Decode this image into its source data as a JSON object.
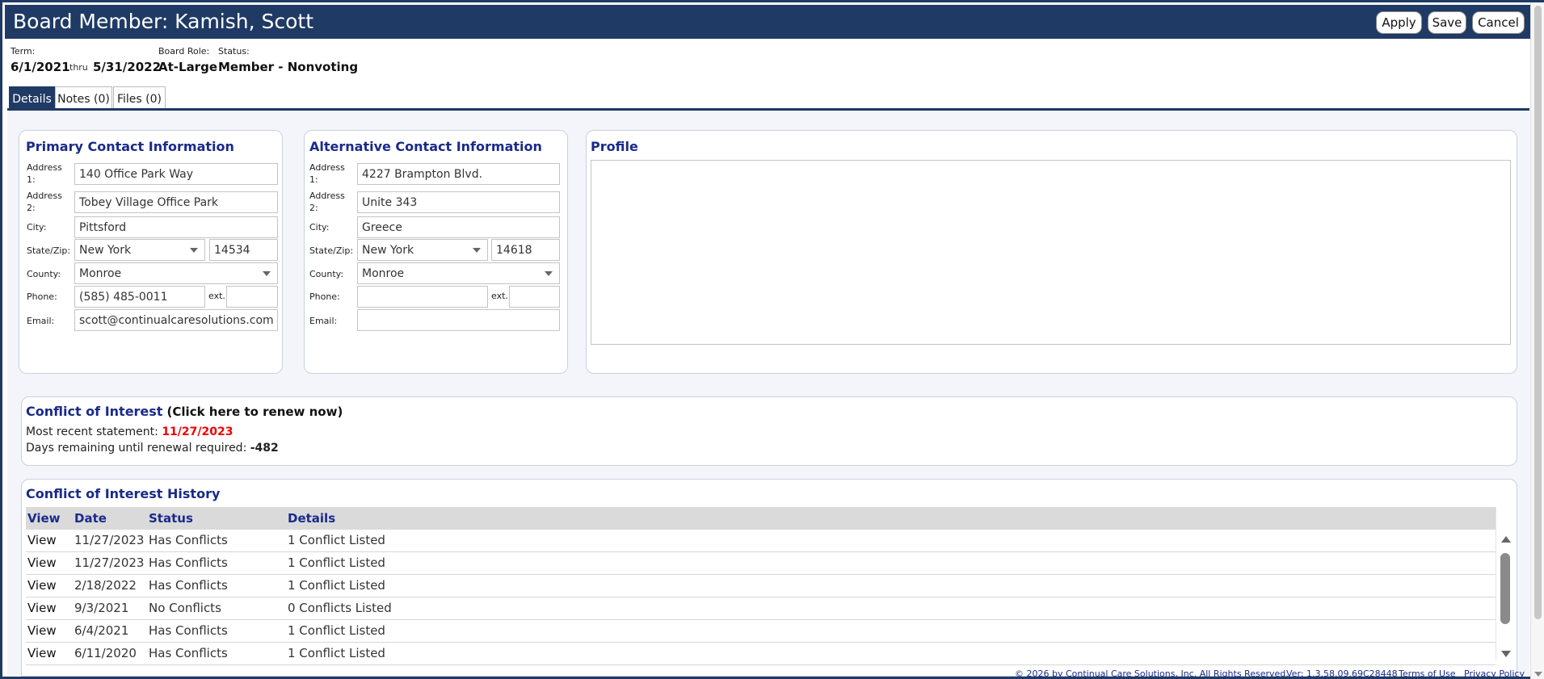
{
  "window": {
    "title": "Board Member: Kamish, Scott",
    "buttons": {
      "apply": "Apply",
      "save": "Save",
      "cancel": "Cancel"
    }
  },
  "summary": {
    "term_label": "Term:",
    "term_start": "6/1/2021",
    "thru_label": "thru",
    "term_end": "5/31/2022",
    "role_label": "Board Role:",
    "role_value": "At-Large",
    "status_label": "Status:",
    "status_value": "Member - Nonvoting"
  },
  "tabs": [
    {
      "label": "Details",
      "active": true
    },
    {
      "label": "Notes (0)",
      "active": false
    },
    {
      "label": "Files (0)",
      "active": false
    }
  ],
  "labels": {
    "address1_a": "Address",
    "address1_b": "1:",
    "address2_a": "Address",
    "address2_b": "2:",
    "city": "City:",
    "statezip": "State/Zip:",
    "county": "County:",
    "phone": "Phone:",
    "ext": "ext.",
    "email": "Email:"
  },
  "primary": {
    "title": "Primary Contact Information",
    "address1": "140 Office Park Way",
    "address2": "Tobey Village Office Park",
    "city": "Pittsford",
    "state": "New York",
    "zip": "14534",
    "county": "Monroe",
    "phone": "(585) 485-0011",
    "ext": "",
    "email": "scott@continualcaresolutions.com"
  },
  "alternative": {
    "title": "Alternative Contact Information",
    "address1": "4227 Brampton Blvd.",
    "address2": "Unite 343",
    "city": "Greece",
    "state": "New York",
    "zip": "14618",
    "county": "Monroe",
    "phone": "",
    "ext": "",
    "email": ""
  },
  "profile": {
    "title": "Profile",
    "text": ""
  },
  "coi": {
    "title": "Conflict of Interest",
    "renew_link": "(Click here to renew now)",
    "recent_label": "Most recent statement:",
    "recent_value": "11/27/2023",
    "days_label": "Days remaining until renewal required:",
    "days_value": "-482"
  },
  "history": {
    "title": "Conflict of Interest History",
    "columns": [
      "View",
      "Date",
      "Status",
      "Details"
    ],
    "rows": [
      {
        "view": "View",
        "date": "11/27/2023",
        "status": "Has Conflicts",
        "details": "1 Conflict Listed"
      },
      {
        "view": "View",
        "date": "11/27/2023",
        "status": "Has Conflicts",
        "details": "1 Conflict Listed"
      },
      {
        "view": "View",
        "date": "2/18/2022",
        "status": "Has Conflicts",
        "details": "1 Conflict Listed"
      },
      {
        "view": "View",
        "date": "9/3/2021",
        "status": "No Conflicts",
        "details": "0 Conflicts Listed"
      },
      {
        "view": "View",
        "date": "6/4/2021",
        "status": "Has Conflicts",
        "details": "1 Conflict Listed"
      },
      {
        "view": "View",
        "date": "6/11/2020",
        "status": "Has Conflicts",
        "details": "1 Conflict Listed"
      }
    ]
  },
  "footer": {
    "copyright": "© 2026 by Continual Care Solutions, Inc. All Rights Reserved.",
    "version": "Ver: 1.3.58.09.69C28448",
    "terms": "Terms of Use",
    "privacy": "Privacy Policy"
  },
  "colors": {
    "titlebar": "#1f3a64",
    "heading": "#1a2a8a",
    "alert": "#e00000"
  }
}
